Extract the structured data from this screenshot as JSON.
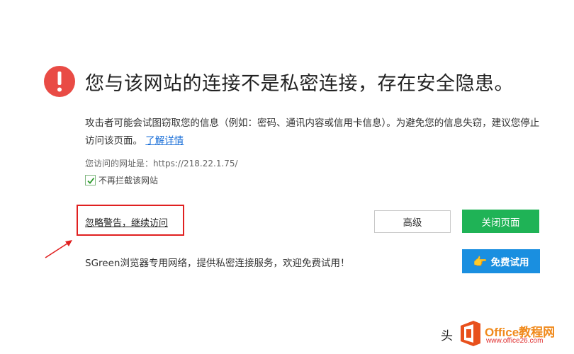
{
  "warning": {
    "headline": "您与该网站的连接不是私密连接，存在安全隐患。",
    "description": "攻击者可能会试图窃取您的信息（例如：密码、通讯内容或信用卡信息）。为避免您的信息失窃，建议您停止访问该页面。",
    "learn_more": "了解详情",
    "url_line": "您访问的网址是：https://218.22.1.75/",
    "checkbox_label": "不再拦截该网站",
    "checkbox_checked": true
  },
  "actions": {
    "ignore_link": "忽略警告，继续访问",
    "advanced": "高级",
    "close_page": "关闭页面",
    "free_trial": "免费试用"
  },
  "promo": {
    "text": "SGreen浏览器专用网络，提供私密连接服务，欢迎免费试用！"
  },
  "watermark": {
    "prefix": "头",
    "site_name": "Office教程网",
    "site_url": "www.office26.com"
  },
  "colors": {
    "warning_red": "#e94b45",
    "annotation_red": "#e02020",
    "close_green": "#1fb356",
    "trial_blue": "#1a8fe0",
    "link_blue": "#1a6fd8"
  },
  "icons": {
    "warning": "exclamation-circle-icon",
    "hand": "pointing-hand-icon",
    "check": "checkmark-icon",
    "arrow": "arrow-up-right-icon",
    "logo": "office-logo-icon"
  }
}
